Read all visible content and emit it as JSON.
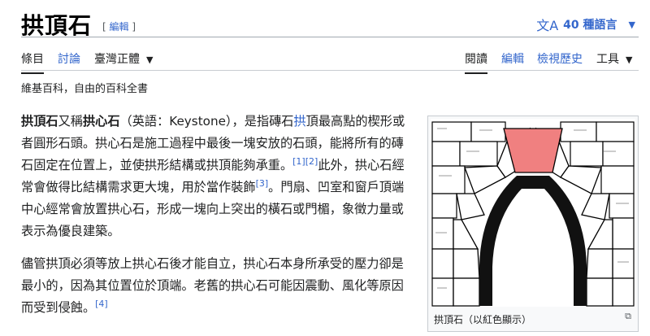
{
  "title": "拱頂石",
  "edit_bracket": {
    "open": "[",
    "label": "編輯",
    "close": "]"
  },
  "language_button": {
    "icon": "文A",
    "label": "40 種語言"
  },
  "tabs_left": [
    {
      "label": "條目"
    },
    {
      "label": "討論"
    },
    {
      "label": "臺灣正體"
    }
  ],
  "tabs_right": [
    {
      "label": "閱讀"
    },
    {
      "label": "編輯"
    },
    {
      "label": "檢視歷史"
    },
    {
      "label": "工具"
    }
  ],
  "tagline": "維基百科，自由的百科全書",
  "paragraph1": {
    "b1": "拱頂石",
    "t1": "又稱",
    "b2": "拱心石",
    "t2": "（英語：Keystone），是指磚石",
    "link": "拱",
    "t3": "頂最高點的楔形或者圓形石頭。拱心石是施工過程中最後一塊安放的石頭，能將所有的磚石固定在位置上，並使拱形結構或拱頂能夠承重。",
    "ref1": "[1]",
    "ref2": "[2]",
    "t4": "此外，拱心石經常會做得比結構需求更大塊，用於當作裝飾",
    "ref3": "[3]",
    "t5": "。門扇、凹室和窗戶頂端中心經常會放置拱心石，形成一塊向上突出的橫石或門楣，象徵力量或表示為優良建築。"
  },
  "paragraph2": {
    "t1": "儘管拱頂必須等放上拱心石後才能自立，拱心石本身所承受的壓力卻是最小的，因為其位置位於頂端。老舊的拱心石可能因震動、風化等原因而受到侵蝕。",
    "ref4": "[4]"
  },
  "figure": {
    "caption": "拱頂石（以紅色顯示）",
    "keystone_color": "#f08080"
  },
  "colors": {
    "link": "#3366cc",
    "text": "#202122"
  }
}
